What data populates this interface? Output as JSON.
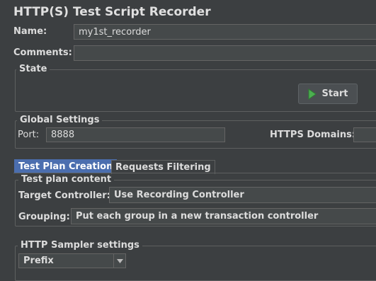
{
  "title": "HTTP(S) Test Script Recorder",
  "name": {
    "label": "Name:",
    "value": "my1st_recorder"
  },
  "comments": {
    "label": "Comments:",
    "value": ""
  },
  "state": {
    "legend": "State",
    "start_label": "Start"
  },
  "global_settings": {
    "legend": "Global Settings",
    "port_label": "Port:",
    "port_value": "8888",
    "https_label": "HTTPS Domains:",
    "https_value": ""
  },
  "tabs": [
    {
      "label": "Test Plan Creation",
      "active": true
    },
    {
      "label": "Requests Filtering",
      "active": false
    }
  ],
  "test_plan_content": {
    "legend": "Test plan content",
    "target_label": "Target Controller:",
    "target_value": "Use Recording Controller",
    "grouping_label": "Grouping:",
    "grouping_value": "Put each group in a new transaction controller"
  },
  "http_sampler": {
    "legend": "HTTP Sampler settings",
    "prefix_value": "Prefix"
  },
  "colors": {
    "background": "#3c3f41",
    "active_tab": "#4b6eaf",
    "start_icon": "#4caf50"
  }
}
